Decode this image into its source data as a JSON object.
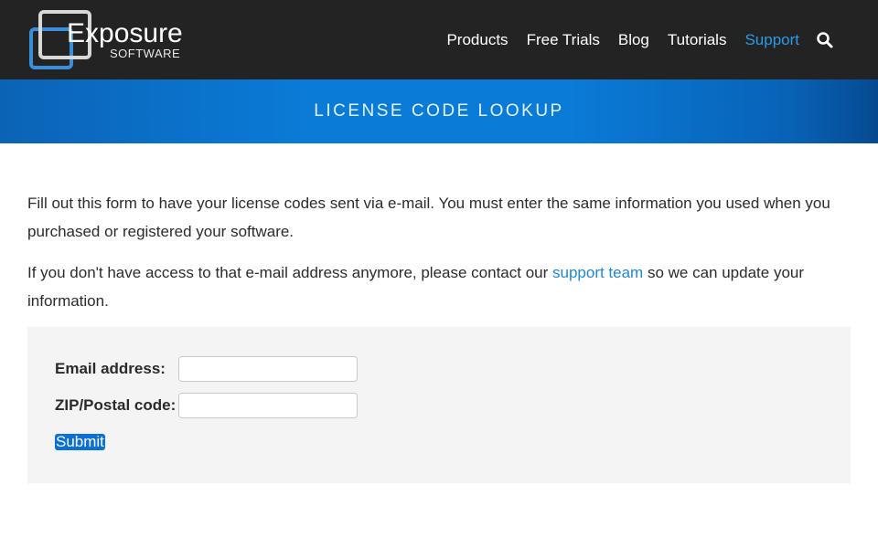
{
  "brand": {
    "name": "Exposure",
    "sub": "SOFTWARE",
    "logo_icon": "exposure-logo-mark"
  },
  "nav": {
    "items": [
      {
        "label": "Products",
        "active": false
      },
      {
        "label": "Free Trials",
        "active": false
      },
      {
        "label": "Blog",
        "active": false
      },
      {
        "label": "Tutorials",
        "active": false
      },
      {
        "label": "Support",
        "active": true
      }
    ],
    "search_icon": "search-icon"
  },
  "banner": {
    "title": "LICENSE CODE LOOKUP"
  },
  "content": {
    "para1": "Fill out this form to have your license codes sent via e-mail. You must enter the same information you used when you purchased or registered your software.",
    "para2_before": "If you don't have access to that e-mail address anymore, please contact our ",
    "para2_link": "support team",
    "para2_after": " so we can update your information."
  },
  "form": {
    "email_label": "Email address:",
    "email_value": "",
    "zip_label": "ZIP/Postal code:",
    "zip_value": "",
    "submit_label": "Submit"
  },
  "colors": {
    "header_bg": "#232323",
    "accent": "#2a9be6",
    "banner": "#0a7bd7",
    "link": "#1e88d6"
  }
}
